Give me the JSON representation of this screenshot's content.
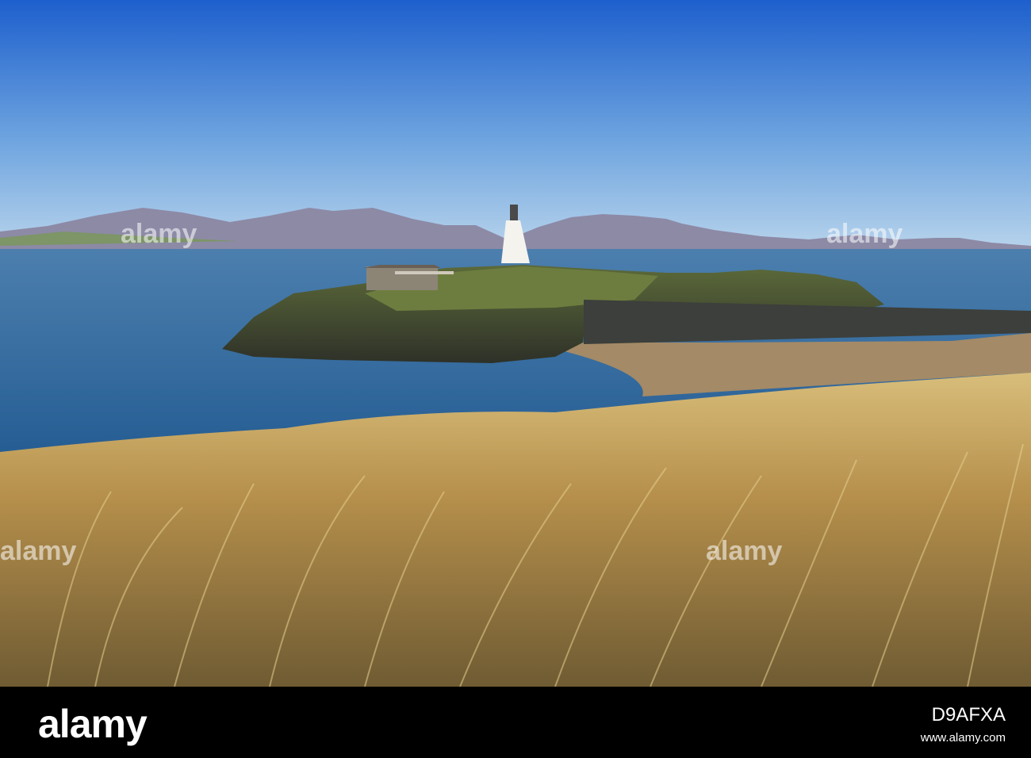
{
  "watermark": {
    "brand": "alamy",
    "color": "#ffffff"
  },
  "footer": {
    "logo_text": "alamy",
    "image_id": "D9AFXA",
    "url": "www.alamy.com",
    "background": "#000000"
  },
  "scene": {
    "description_colors": {
      "sky_top": "#1f64d0",
      "sky_horizon": "#b4d2ec",
      "sea": "#2f6a9c",
      "mountains": "#8b8aa6",
      "grass": "#c9a45a",
      "sand": "#a48c6c"
    }
  }
}
